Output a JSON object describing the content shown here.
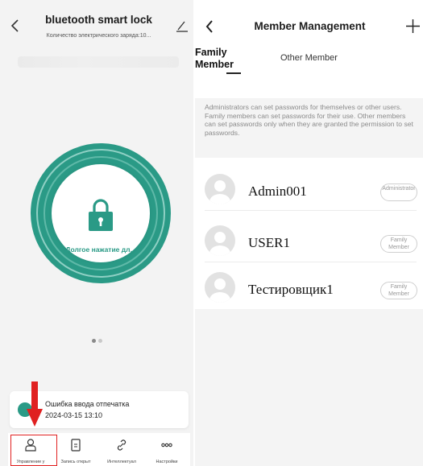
{
  "left_screen": {
    "title": "bluetooth smart lock",
    "subtitle": "Количество электрического заряда:10...",
    "back_icon": "chevron-left-icon",
    "edit_icon": "pencil-icon",
    "lock_button_label": "Долгое нажатие дл...",
    "accent_color": "#2a9a86",
    "alert": {
      "title": "Ошибка ввода отпечатка",
      "time": "2024-03-15 13:10"
    },
    "nav": [
      {
        "label": "Управление у",
        "icon": "person-icon"
      },
      {
        "label": "Запись открыт",
        "icon": "document-icon"
      },
      {
        "label": "Интеллектуал",
        "icon": "link-icon"
      },
      {
        "label": "Настройки",
        "icon": "more-dots-icon"
      }
    ],
    "highlight_color": "#e02020"
  },
  "right_screen": {
    "title": "Member Management",
    "back_icon": "chevron-left-icon",
    "add_icon": "plus-icon",
    "tabs": [
      {
        "label": "Family Member",
        "active": true
      },
      {
        "label": "Other Member",
        "active": false
      }
    ],
    "info_text": "Administrators can set passwords for themselves or other users. Family members can set passwords for their use. Other members can set passwords only when they are granted the permission to set passwords.",
    "members": [
      {
        "name": "Admin001",
        "role": "Administrator"
      },
      {
        "name": "USER1",
        "role": "Family Member"
      },
      {
        "name": "Тестировщик1",
        "role": "Family Member"
      }
    ]
  }
}
